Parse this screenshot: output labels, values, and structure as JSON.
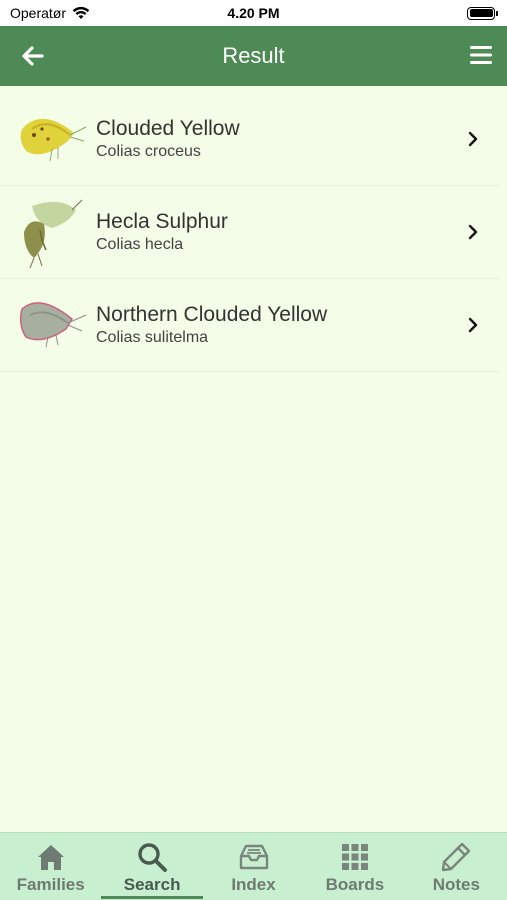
{
  "status": {
    "carrier": "Operatør",
    "time": "4.20 PM"
  },
  "header": {
    "title": "Result"
  },
  "results": [
    {
      "name": "Clouded Yellow",
      "latin": "Colias croceus"
    },
    {
      "name": "Hecla Sulphur",
      "latin": "Colias hecla"
    },
    {
      "name": "Northern Clouded Yellow",
      "latin": "Colias sulitelma"
    }
  ],
  "tabs": [
    {
      "label": "Families",
      "icon": "home-icon"
    },
    {
      "label": "Search",
      "icon": "search-icon"
    },
    {
      "label": "Index",
      "icon": "inbox-icon"
    },
    {
      "label": "Boards",
      "icon": "grid-icon"
    },
    {
      "label": "Notes",
      "icon": "pencil-icon"
    }
  ],
  "active_tab": "Search",
  "colors": {
    "nav": "#4e8a56",
    "background": "#f3fde8",
    "tabbar": "#c8f0d0"
  }
}
